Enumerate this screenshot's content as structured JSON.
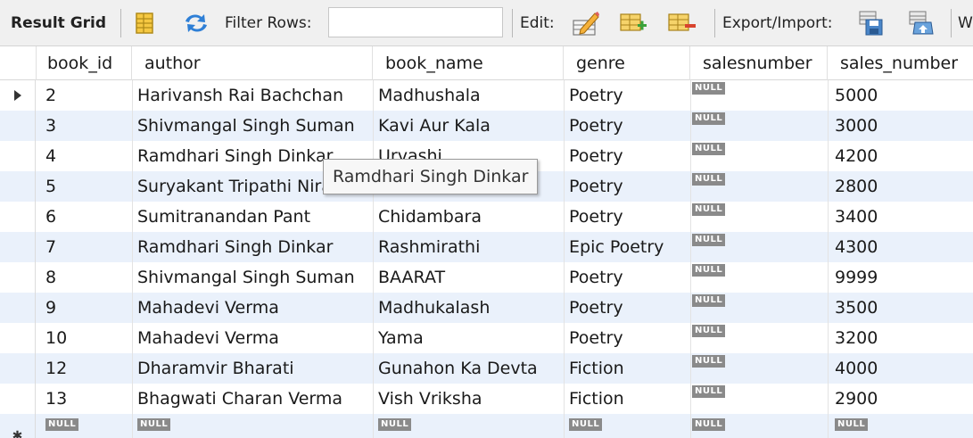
{
  "toolbar": {
    "result_grid_label": "Result Grid",
    "filter_rows_label": "Filter Rows:",
    "filter_rows_value": "",
    "edit_label": "Edit:",
    "export_import_label": "Export/Import:",
    "wrap_label": "W"
  },
  "columns": [
    "book_id",
    "author",
    "book_name",
    "genre",
    "salesnumber",
    "sales_number"
  ],
  "rows": [
    {
      "book_id": "2",
      "author": "Harivansh Rai Bachchan",
      "book_name": "Madhushala",
      "genre": "Poetry",
      "salesnumber": "NULL",
      "sales_number": "5000"
    },
    {
      "book_id": "3",
      "author": "Shivmangal Singh Suman",
      "book_name": "Kavi Aur Kala",
      "genre": "Poetry",
      "salesnumber": "NULL",
      "sales_number": "3000"
    },
    {
      "book_id": "4",
      "author": "Ramdhari Singh Dinkar",
      "book_name": "Urvashi",
      "genre": "Poetry",
      "salesnumber": "NULL",
      "sales_number": "4200"
    },
    {
      "book_id": "5",
      "author": "Suryakant Tripathi Nirala",
      "book_name": "",
      "genre": "Poetry",
      "salesnumber": "NULL",
      "sales_number": "2800"
    },
    {
      "book_id": "6",
      "author": "Sumitranandan Pant",
      "book_name": "Chidambara",
      "genre": "Poetry",
      "salesnumber": "NULL",
      "sales_number": "3400"
    },
    {
      "book_id": "7",
      "author": "Ramdhari Singh Dinkar",
      "book_name": "Rashmirathi",
      "genre": "Epic Poetry",
      "salesnumber": "NULL",
      "sales_number": "4300"
    },
    {
      "book_id": "8",
      "author": "Shivmangal Singh Suman",
      "book_name": "BAARAT",
      "genre": "Poetry",
      "salesnumber": "NULL",
      "sales_number": "9999"
    },
    {
      "book_id": "9",
      "author": "Mahadevi Verma",
      "book_name": "Madhukalash",
      "genre": "Poetry",
      "salesnumber": "NULL",
      "sales_number": "3500"
    },
    {
      "book_id": "10",
      "author": "Mahadevi Verma",
      "book_name": "Yama",
      "genre": "Poetry",
      "salesnumber": "NULL",
      "sales_number": "3200"
    },
    {
      "book_id": "12",
      "author": "Dharamvir Bharati",
      "book_name": "Gunahon Ka Devta",
      "genre": "Fiction",
      "salesnumber": "NULL",
      "sales_number": "4000"
    },
    {
      "book_id": "13",
      "author": "Bhagwati Charan Verma",
      "book_name": "Vish Vriksha",
      "genre": "Fiction",
      "salesnumber": "NULL",
      "sales_number": "2900"
    }
  ],
  "new_row": {
    "book_id": "NULL",
    "author": "NULL",
    "book_name": "NULL",
    "genre": "NULL",
    "salesnumber": "NULL",
    "sales_number": "NULL"
  },
  "tooltip_text": "Ramdhari Singh Dinkar",
  "icons": {
    "grid_view": "grid-view-icon",
    "refresh": "refresh-icon",
    "edit_cell": "edit-cell-icon",
    "add_row": "add-row-icon",
    "delete_row": "delete-row-icon",
    "export": "export-icon",
    "import": "import-icon",
    "current_row": "row-pointer-icon",
    "new_row": "new-row-asterisk-icon"
  },
  "colors": {
    "alt_row": "#eaf1fb",
    "null_badge": "#8a8a8a",
    "toolbar_bg": "#f0f0f0"
  }
}
